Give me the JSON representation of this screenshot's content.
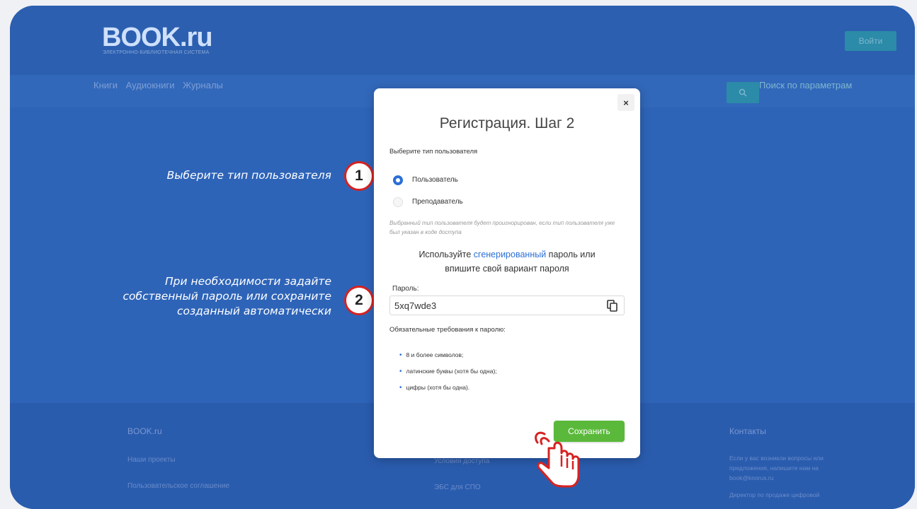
{
  "site": {
    "logo": "BOOK.ru",
    "logo_sub": "ЭЛЕКТРОННО-БИБЛИОТЕЧНАЯ СИСТЕМА",
    "login_label": "Войти",
    "nav": [
      "Книги",
      "Аудиокниги",
      "Журналы"
    ],
    "search_icon": "search-icon",
    "param_search": "Поиск по параметрам"
  },
  "footer": {
    "col1_title": "BOOK.ru",
    "col1_items": [
      "Наши проекты",
      "Пользовательское соглашение"
    ],
    "col2_items": [
      "Условия доступа",
      "ЭБС для СПО"
    ],
    "col3_title": "Контакты",
    "col3_text": "Если у вас возникли вопросы или предложения, напишите нам на book@knorus.ru",
    "col3_extra": "Директор по продаже цифровой"
  },
  "annotations": {
    "step1_badge": "1",
    "step1_text": "Выберите тип пользователя",
    "step2_badge": "2",
    "step2_lines": [
      "При необходимости задайте",
      "собственный пароль или сохраните",
      "созданный автоматически"
    ]
  },
  "modal": {
    "close_label": "×",
    "title": "Регистрация. Шаг 2",
    "user_type_label": "Выберите тип пользователя",
    "options": [
      {
        "label": "Пользователь",
        "selected": true
      },
      {
        "label": "Преподаватель",
        "selected": false
      }
    ],
    "note": "Выбранный тип пользователя будет проигнорирован, если тип пользователя уже был указан в коде доступа",
    "pw_hint_part1": "Используйте",
    "pw_hint_link": "сгенерированный",
    "pw_hint_part2": "пароль или",
    "pw_hint_line2": "впишите свой вариант пароля",
    "password_label": "Пароль:",
    "password_value": "5xq7wde3",
    "requirements_title": "Обязательные требования к паролю:",
    "requirements": [
      "8 и более символов;",
      "латинские буквы (хотя бы одна);",
      "цифры (хотя бы одна)."
    ],
    "save_label": "Сохранить"
  },
  "colors": {
    "background_blue": "#2e64b8",
    "accent_blue": "#2b6fd6",
    "save_green": "#5ab93a",
    "badge_red": "#d62222"
  }
}
